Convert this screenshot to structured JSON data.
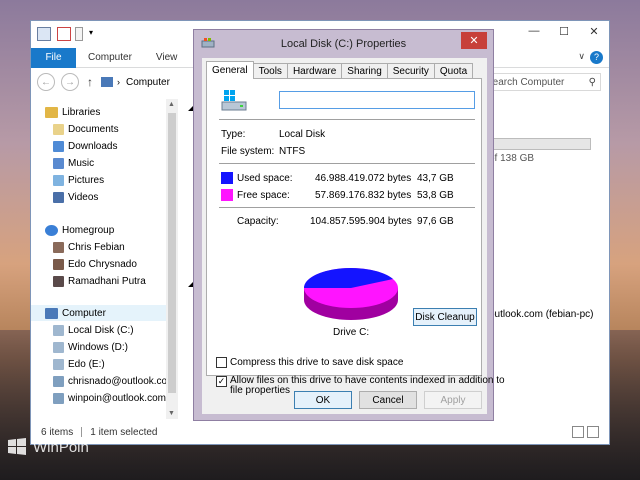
{
  "explorer": {
    "title": "Computer",
    "ribbon": {
      "file": "File",
      "tabs": [
        "Computer",
        "View"
      ]
    },
    "address": "Computer",
    "search_placeholder": "Search Computer",
    "nav": {
      "libraries": "Libraries",
      "library_items": [
        "Documents",
        "Downloads",
        "Music",
        "Pictures",
        "Videos"
      ],
      "homegroup": "Homegroup",
      "homegroup_items": [
        "Chris Febian",
        "Edo Chrysnado",
        "Ramadhani Putra"
      ],
      "computer": "Computer",
      "computer_items": [
        "Local Disk (C:)",
        "Windows (D:)",
        "Edo (E:)",
        "chrisnado@outlook.co",
        "winpoin@outlook.com"
      ]
    },
    "content": {
      "drive_free_text": "of 138 GB",
      "drive_used_fraction": 0.45,
      "network_item": "outlook.com (febian-pc)"
    },
    "status": {
      "items": "6 items",
      "selected": "1 item selected"
    }
  },
  "dialog": {
    "title": "Local Disk (C:) Properties",
    "tabs": [
      "General",
      "Tools",
      "Hardware",
      "Sharing",
      "Security",
      "Quota"
    ],
    "active_tab": "General",
    "name_value": "",
    "type_label": "Type:",
    "type_value": "Local Disk",
    "fs_label": "File system:",
    "fs_value": "NTFS",
    "used_label": "Used space:",
    "used_bytes": "46.988.419.072 bytes",
    "used_gb": "43,7 GB",
    "free_label": "Free space:",
    "free_bytes": "57.869.176.832 bytes",
    "free_gb": "53,8 GB",
    "capacity_label": "Capacity:",
    "capacity_bytes": "104.857.595.904 bytes",
    "capacity_gb": "97,6 GB",
    "drive_label": "Drive C:",
    "cleanup_button": "Disk Cleanup",
    "compress_label": "Compress this drive to save disk space",
    "compress_checked": false,
    "index_label_1": "Allow files on this drive to have contents indexed in addition to",
    "index_label_2": "file properties",
    "index_checked": true,
    "ok": "OK",
    "cancel": "Cancel",
    "apply": "Apply",
    "used_color": "#1414ff",
    "free_color": "#ff14ff"
  },
  "watermark": "WinPoin"
}
